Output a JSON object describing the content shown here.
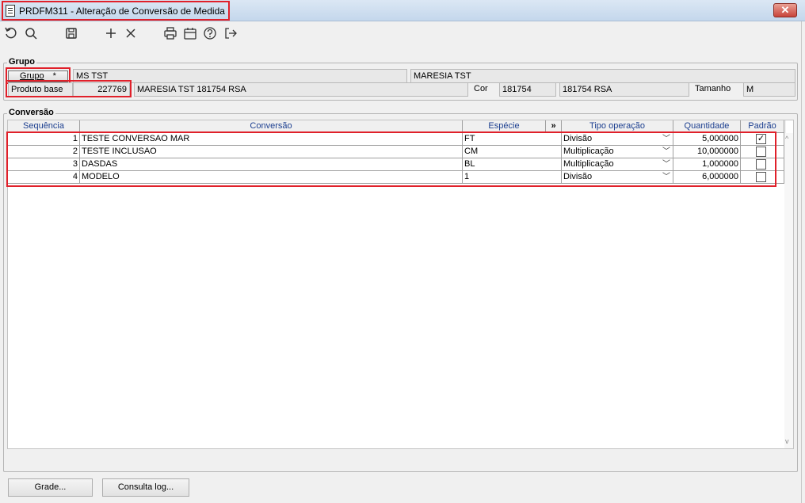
{
  "window": {
    "title": "PRDFM311 - Alteração de Conversão de Medida",
    "close_glyph": "✕",
    "title_icon": "document-icon"
  },
  "toolbar": {
    "icons": [
      "refresh-icon",
      "search-icon",
      "save-icon",
      "add-icon",
      "delete-icon",
      "print-icon",
      "calendar-icon",
      "help-icon",
      "exit-icon"
    ]
  },
  "grupo": {
    "section_title": "Grupo",
    "grupo_button_label": "Grupo",
    "grupo_required_mark": "*",
    "grupo_code": "MS TST",
    "grupo_name": "MARESIA TST",
    "produto_base_label": "Produto base",
    "produto_base_code": "227769",
    "produto_base_desc": "MARESIA TST 181754 RSA",
    "cor_label": "Cor",
    "cor_code": "181754",
    "cor_desc": "181754 RSA",
    "tamanho_label": "Tamanho",
    "tamanho_value": "M"
  },
  "conversao": {
    "section_title": "Conversão",
    "columns": {
      "sequencia": "Sequência",
      "conversao": "Conversão",
      "especie": "Espécie",
      "expand": "»",
      "tipo_operacao": "Tipo operação",
      "quantidade": "Quantidade",
      "padrao": "Padrão"
    },
    "rows": [
      {
        "seq": "1",
        "conversao": "TESTE CONVERSAO MAR",
        "especie": "FT",
        "tipo": "Divisão",
        "quantidade": "5,000000",
        "padrao": true
      },
      {
        "seq": "2",
        "conversao": "TESTE INCLUSAO",
        "especie": "CM",
        "tipo": "Multiplicação",
        "quantidade": "10,000000",
        "padrao": false
      },
      {
        "seq": "3",
        "conversao": "DASDAS",
        "especie": "BL",
        "tipo": "Multiplicação",
        "quantidade": "1,000000",
        "padrao": false
      },
      {
        "seq": "4",
        "conversao": "MODELO",
        "especie": "1",
        "tipo": "Divisão",
        "quantidade": "6,000000",
        "padrao": false
      }
    ],
    "checked_glyph": "✓",
    "dropdown_glyph": "﹀",
    "scroll_up_glyph": "^",
    "scroll_down_glyph": "v"
  },
  "footer": {
    "grade_button": "Grade...",
    "consulta_log_button": "Consulta log..."
  },
  "colors": {
    "highlight": "#e0202a",
    "header_text": "#1b3e8f"
  }
}
